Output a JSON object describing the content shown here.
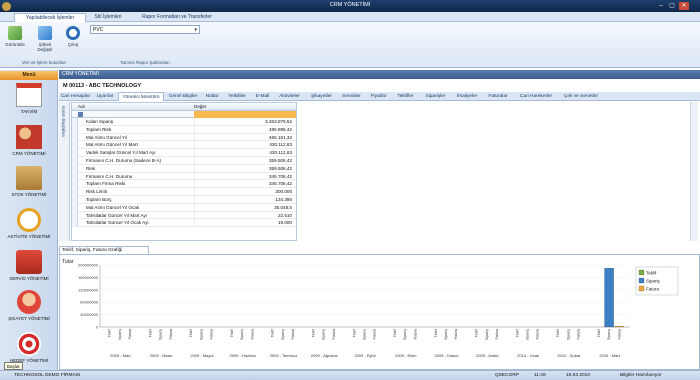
{
  "window": {
    "title": "CRM YÖNETİMİ",
    "controls": [
      "–",
      "▢",
      "✕"
    ]
  },
  "ribbon": {
    "tabs": [
      {
        "label": "Yapılabilecek İşlemler",
        "active": true
      },
      {
        "label": "Stil İşlemleri",
        "active": false
      },
      {
        "label": "Rapor Formatları ve Transferler",
        "active": false
      }
    ],
    "buttons": [
      {
        "label": "Görüntüle",
        "icon": "view-icon",
        "color": "#4f9a3a"
      },
      {
        "label": "Şirketi Değiştir",
        "icon": "switch-icon",
        "color": "#2f7fd0"
      },
      {
        "label": "Çıkış",
        "icon": "exit-icon",
        "color": "#2a6fb8"
      }
    ],
    "group1_caption": "Veri ve İşlem butonları",
    "combo_value": "PVC",
    "group2_caption": "Tanımlı Rapor Şablonları"
  },
  "sidebar": {
    "header": "Menü",
    "items": [
      {
        "label": "TAKVİM",
        "icon": "calendar-icon"
      },
      {
        "label": "CRM YÖNETİMİ",
        "icon": "people-icon"
      },
      {
        "label": "STOK YÖNETİMİ",
        "icon": "boxes-icon"
      },
      {
        "label": "AKTİVİTE YÖNETİMİ",
        "icon": "clock-icon"
      },
      {
        "label": "SERVİS YÖNETİMİ",
        "icon": "toolbox-icon"
      },
      {
        "label": "ŞİKAYET YÖNETİMİ",
        "icon": "person-icon"
      },
      {
        "label": "HEDEF YÖNETİMİ",
        "icon": "target-icon"
      }
    ]
  },
  "main": {
    "header": "CRM YÖNETİMİ",
    "customer": "M  00113  -  ABC TECHNOLOGY",
    "tabs": [
      {
        "label": "Cari Hesaplar",
        "active": false
      },
      {
        "label": "Uyarılar",
        "active": false
      },
      {
        "label": "Yönetici Monitörü",
        "active": true
      },
      {
        "label": "Genel Bilgiler",
        "active": false
      },
      {
        "label": "Notlar",
        "active": false
      },
      {
        "label": "Yetkililer",
        "active": false
      },
      {
        "label": "E-Mail",
        "active": false
      },
      {
        "label": "Aktiviteler",
        "active": false
      },
      {
        "label": "Şikayetler",
        "active": false
      },
      {
        "label": "Servisler",
        "active": false
      },
      {
        "label": "Fiyatlar",
        "active": false
      },
      {
        "label": "Teklifler",
        "active": false
      },
      {
        "label": "Siparişler",
        "active": false
      },
      {
        "label": "İrsaliyeler",
        "active": false
      },
      {
        "label": "Faturalar",
        "active": false
      },
      {
        "label": "Cari Hareketler",
        "active": false
      },
      {
        "label": "Çek ve Senetler",
        "active": false
      }
    ],
    "side_strip": "Kolon Başlıkları",
    "grid": {
      "col1": "Adı",
      "col2": "Değer",
      "rows": [
        {
          "name": "Kalan Sipariş",
          "value": "3.263.879,52"
        },
        {
          "name": "Toplam Risk",
          "value": "485.896,42"
        },
        {
          "name": "Mal Alımı Güncel Yıl",
          "value": "465.161,33"
        },
        {
          "name": "Mal Alımı Güncel Yıl  Mart",
          "value": "430.112,83"
        },
        {
          "name": "Vadeli Satışlar Güncel Yıl Mart Ayı",
          "value": "430.112,83"
        },
        {
          "name": "Firmanın C.H. Durumu (Sadece B-A)",
          "value": "359.506,42"
        },
        {
          "name": "Risk",
          "value": "359.506,42"
        },
        {
          "name": "Firmanın C.H. Durumu",
          "value": "345.706,42"
        },
        {
          "name": "Toplam Firma Riski",
          "value": "345.706,42"
        },
        {
          "name": "Risk Limiti",
          "value": "300.000"
        },
        {
          "name": "Toplam Borç",
          "value": "134.390"
        },
        {
          "name": "Mal Alımı Güncel Yıl  Ocak",
          "value": "35.048,5"
        },
        {
          "name": "Tahsilatlar Güncel Yıl Mart Ayı",
          "value": "22.510"
        },
        {
          "name": "Tahsilatlar Güncel Yıl Ocak Ayı",
          "value": "19.000"
        }
      ]
    },
    "bottom_tab": "Teklif, Sipariş, Fatura Grafiği"
  },
  "chart_data": {
    "type": "bar",
    "ylabel": "Tutar",
    "yticks": [
      "200000000",
      "160000000",
      "120000000",
      "80000000",
      "40000000",
      "0"
    ],
    "ylim": [
      0,
      200000000
    ],
    "groups": [
      "2009 - Mart",
      "2009 - Nisan",
      "2009 - Mayıs",
      "2009 - Haziran",
      "2009 - Temmuz",
      "2009 - Ağustos",
      "2009 - Eylül",
      "2009 - Ekim",
      "2009 - Kasım",
      "2009 - Aralık",
      "2010 - Ocak",
      "2010 - Şubat",
      "2010 - Mart"
    ],
    "categories": [
      "Teklif",
      "Sipariş",
      "Fatura"
    ],
    "series": [
      {
        "name": "Teklif",
        "color": "#7ea843",
        "values": [
          0,
          0,
          0,
          0,
          0,
          0,
          0,
          0,
          0,
          0,
          0,
          0,
          0
        ]
      },
      {
        "name": "Sipariş",
        "color": "#3b7fc4",
        "values": [
          0,
          0,
          0,
          0,
          0,
          0,
          0,
          0,
          0,
          0,
          0,
          0,
          190000000
        ]
      },
      {
        "name": "Fatura",
        "color": "#e8a83a",
        "values": [
          0,
          0,
          0,
          0,
          0,
          0,
          0,
          0,
          0,
          0,
          0,
          0,
          3000000
        ]
      }
    ],
    "legend": "right"
  },
  "statusbar": {
    "company": "TECHNOSOL DEMO FİRMASI",
    "user": "QSECORP",
    "time": "11:49",
    "date": "16.03.2010",
    "status": "Bilgiler Hazırlanıyor"
  },
  "tooltip": "Başlat"
}
